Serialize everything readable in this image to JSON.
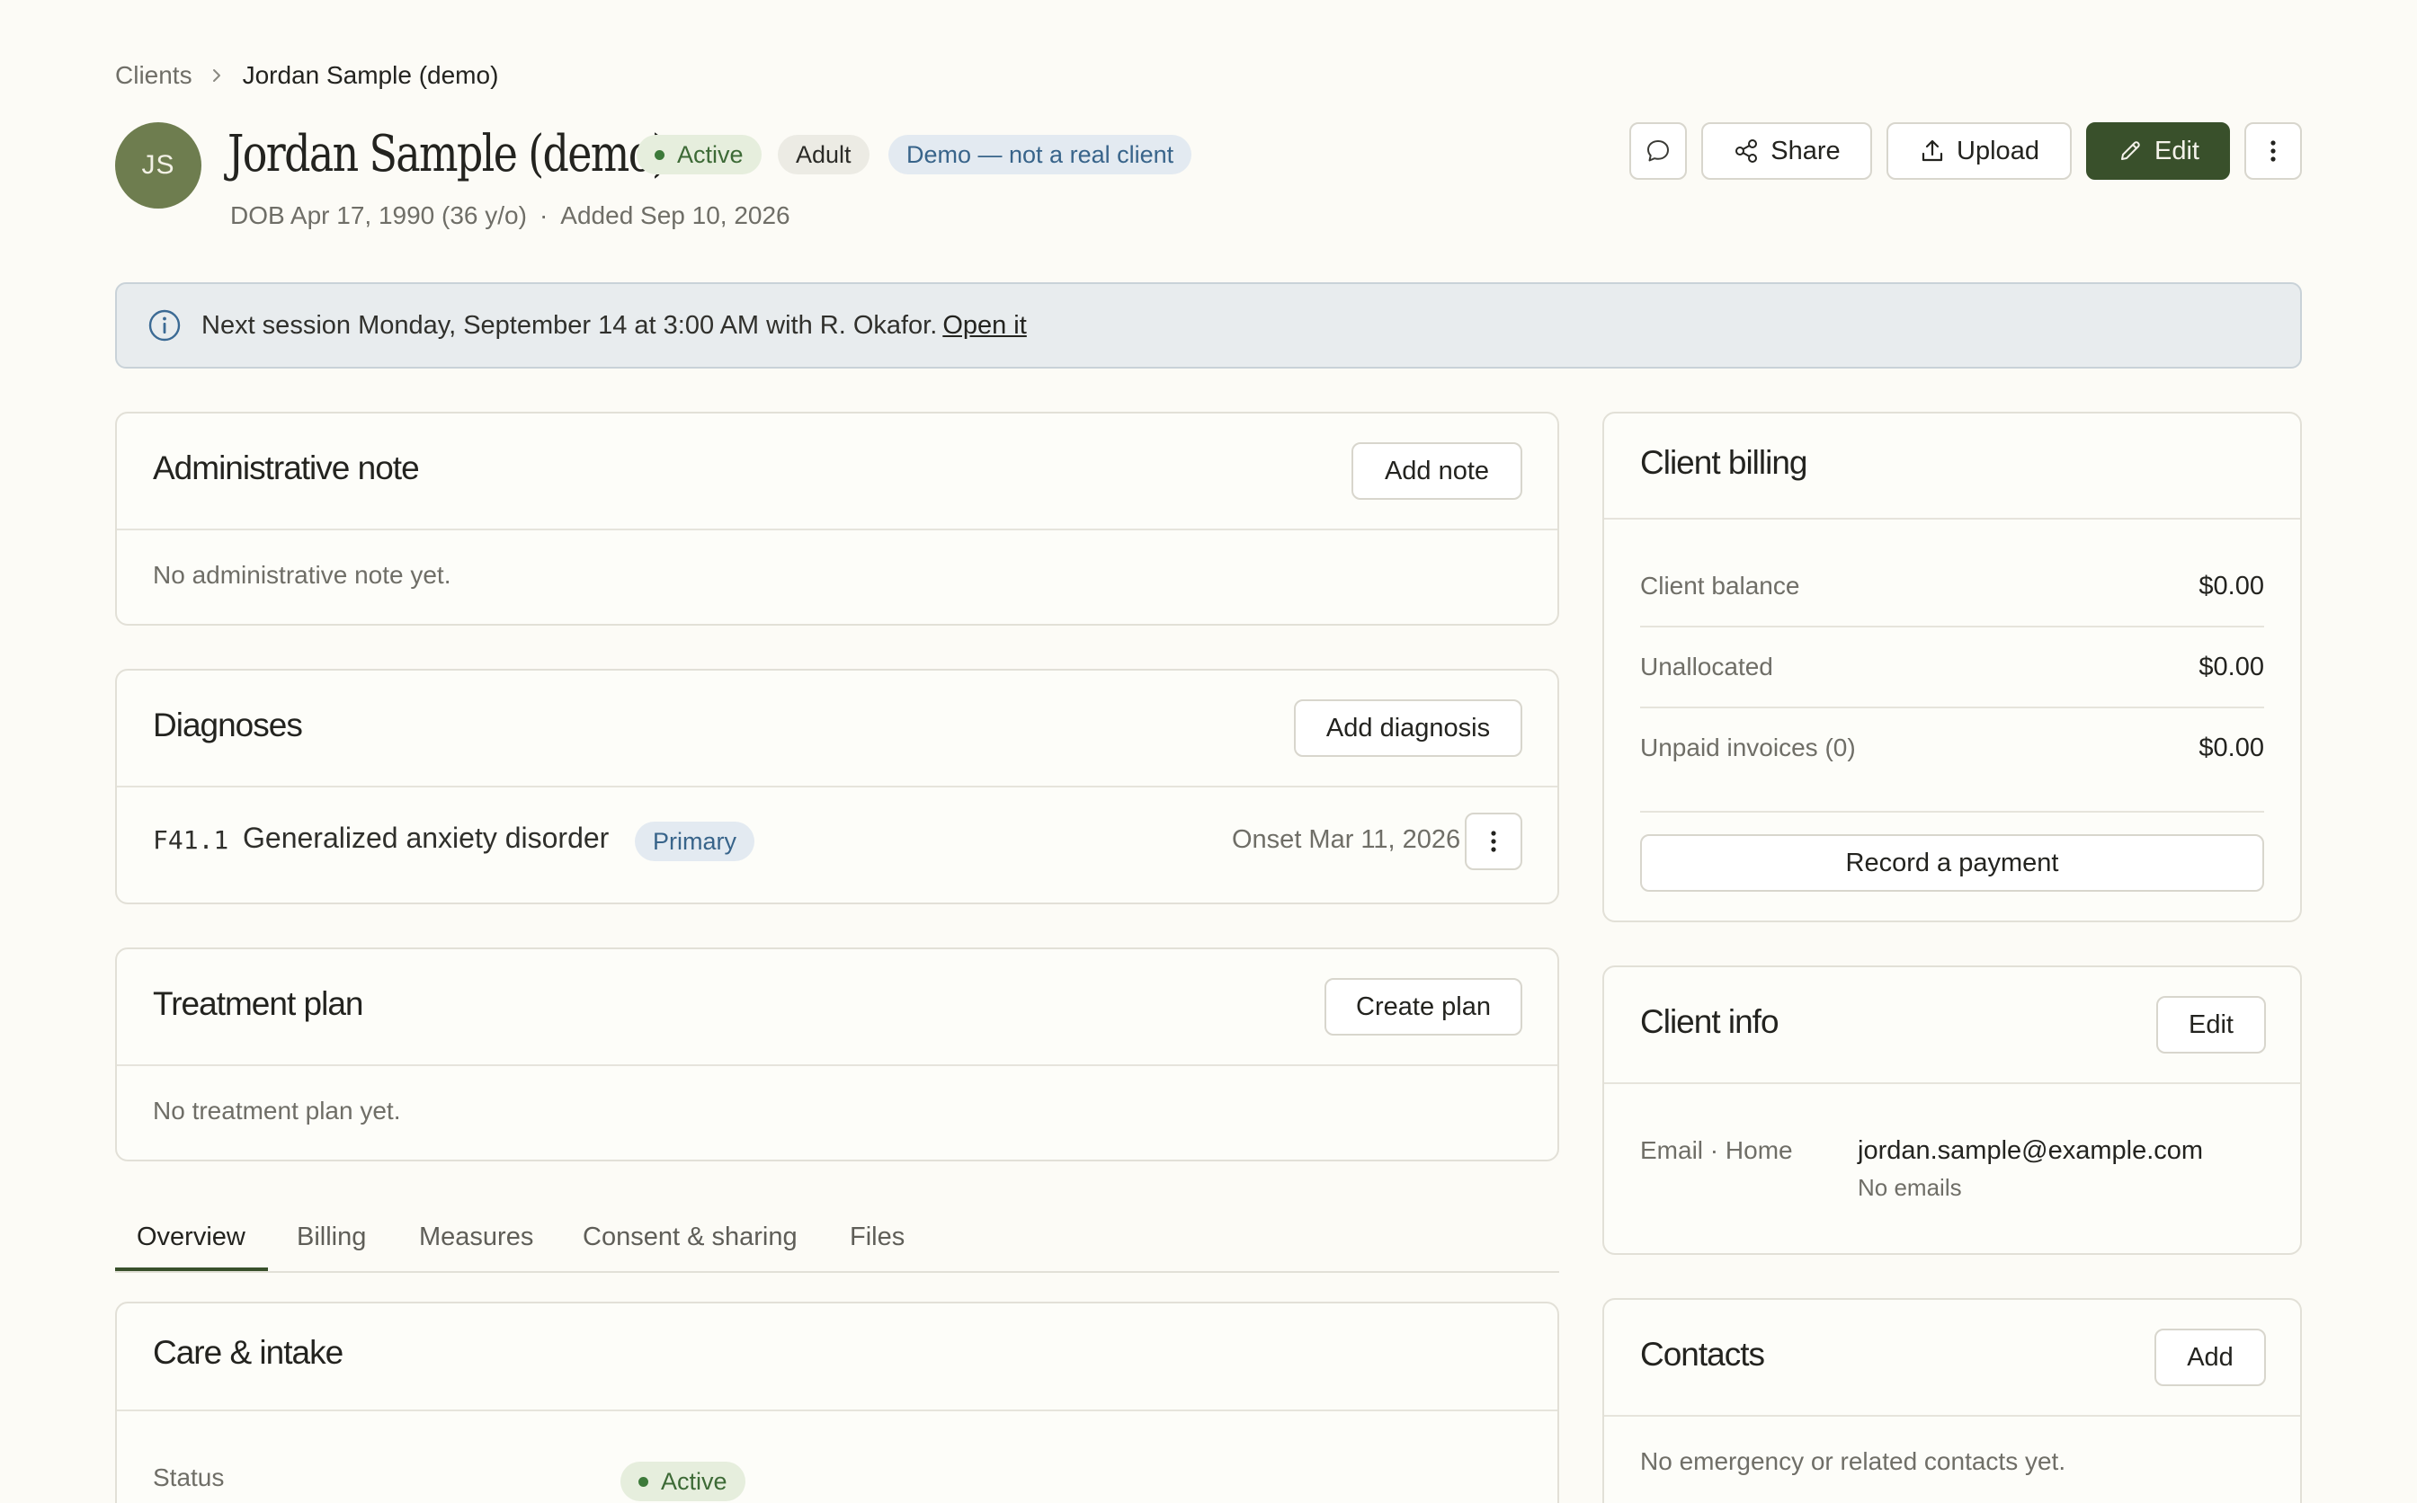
{
  "breadcrumb": {
    "parent": "Clients",
    "current": "Jordan Sample (demo)"
  },
  "client": {
    "initials": "JS",
    "name": "Jordan Sample (demo)",
    "status_badge": "Active",
    "age_badge": "Adult",
    "demo_badge": "Demo — not a real client",
    "dob": "DOB Apr 17, 1990 (36 y/o)",
    "added": "Added Sep 10, 2026"
  },
  "actions": {
    "share": "Share",
    "upload": "Upload",
    "edit": "Edit"
  },
  "banner": {
    "text": "Next session Monday, September 14 at 3:00 AM with R. Okafor.",
    "link": "Open it"
  },
  "admin_note": {
    "title": "Administrative note",
    "button": "Add note",
    "empty": "No administrative note yet."
  },
  "diagnoses": {
    "title": "Diagnoses",
    "button": "Add diagnosis",
    "items": [
      {
        "code": "F41.1",
        "name": "Generalized anxiety disorder",
        "badge": "Primary",
        "onset": "Onset Mar 11, 2026"
      }
    ]
  },
  "treatment_plan": {
    "title": "Treatment plan",
    "button": "Create plan",
    "empty": "No treatment plan yet."
  },
  "tabs": [
    "Overview",
    "Billing",
    "Measures",
    "Consent & sharing",
    "Files"
  ],
  "care_intake": {
    "title": "Care & intake",
    "status_label": "Status",
    "status_value": "Active"
  },
  "billing": {
    "title": "Client billing",
    "rows": [
      {
        "label": "Client balance",
        "value": "$0.00"
      },
      {
        "label": "Unallocated",
        "value": "$0.00"
      },
      {
        "label": "Unpaid invoices (0)",
        "value": "$0.00"
      }
    ],
    "button": "Record a payment"
  },
  "client_info": {
    "title": "Client info",
    "button": "Edit",
    "email_label": "Email · Home",
    "email_value": "jordan.sample@example.com",
    "email_note": "No emails"
  },
  "contacts": {
    "title": "Contacts",
    "button": "Add",
    "empty": "No emergency or related contacts yet."
  },
  "colors": {
    "background": "#fcfbf6",
    "primary_button": "#39502b",
    "avatar": "#6e7d4f",
    "active_green": "#3d6a36",
    "demo_blue": "#38648a"
  }
}
